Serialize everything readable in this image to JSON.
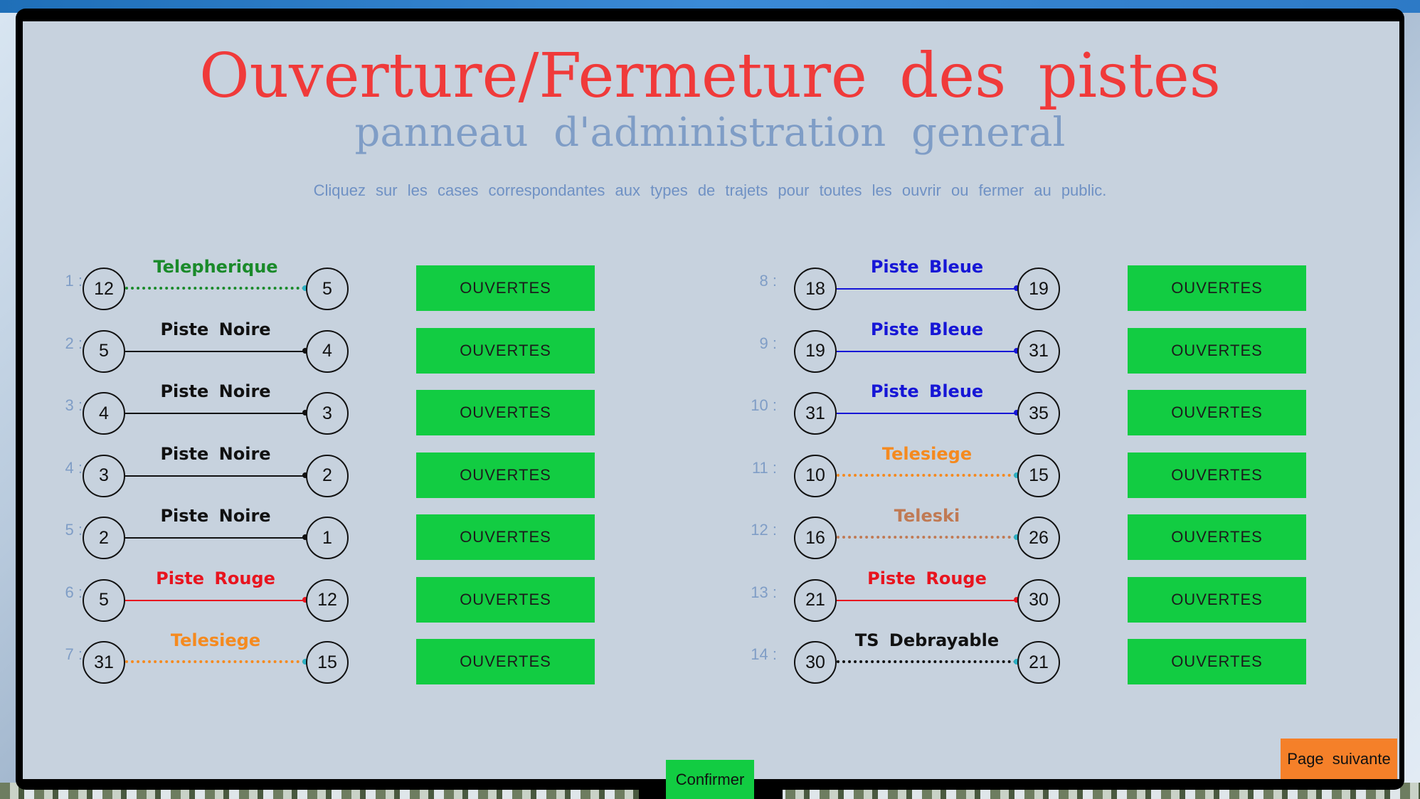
{
  "header": {
    "title": "Ouverture/Fermeture des pistes",
    "subtitle": "panneau d'administration general",
    "instruction": "Cliquez sur les cases correspondantes aux types de trajets pour toutes les ouvrir ou fermer au public."
  },
  "routes": [
    {
      "index": "1 :",
      "from": "12",
      "to": "5",
      "type": "Telepherique",
      "status": "OUVERTES",
      "color": "#1a8a2a",
      "style": "dotted",
      "end": "#2bb0c4"
    },
    {
      "index": "2 :",
      "from": "5",
      "to": "4",
      "type": "Piste Noire",
      "status": "OUVERTES",
      "color": "#111111",
      "style": "solid",
      "end": "#111111"
    },
    {
      "index": "3 :",
      "from": "4",
      "to": "3",
      "type": "Piste Noire",
      "status": "OUVERTES",
      "color": "#111111",
      "style": "solid",
      "end": "#111111"
    },
    {
      "index": "4 :",
      "from": "3",
      "to": "2",
      "type": "Piste Noire",
      "status": "OUVERTES",
      "color": "#111111",
      "style": "solid",
      "end": "#111111"
    },
    {
      "index": "5 :",
      "from": "2",
      "to": "1",
      "type": "Piste Noire",
      "status": "OUVERTES",
      "color": "#111111",
      "style": "solid",
      "end": "#111111"
    },
    {
      "index": "6 :",
      "from": "5",
      "to": "12",
      "type": "Piste Rouge",
      "status": "OUVERTES",
      "color": "#e8141e",
      "style": "solid",
      "end": "#e8141e"
    },
    {
      "index": "7 :",
      "from": "31",
      "to": "15",
      "type": "Telesiege",
      "status": "OUVERTES",
      "color": "#f58a1f",
      "style": "dotted",
      "end": "#2bb0c4"
    },
    {
      "index": "8 :",
      "from": "18",
      "to": "19",
      "type": "Piste Bleue",
      "status": "OUVERTES",
      "color": "#1616d6",
      "style": "solid",
      "end": "#1616d6"
    },
    {
      "index": "9 :",
      "from": "19",
      "to": "31",
      "type": "Piste Bleue",
      "status": "OUVERTES",
      "color": "#1616d6",
      "style": "solid",
      "end": "#1616d6"
    },
    {
      "index": "10 :",
      "from": "31",
      "to": "35",
      "type": "Piste Bleue",
      "status": "OUVERTES",
      "color": "#1616d6",
      "style": "solid",
      "end": "#1616d6"
    },
    {
      "index": "11 :",
      "from": "10",
      "to": "15",
      "type": "Telesiege",
      "status": "OUVERTES",
      "color": "#f58a1f",
      "style": "dotted",
      "end": "#2bb0c4"
    },
    {
      "index": "12 :",
      "from": "16",
      "to": "26",
      "type": "Teleski",
      "status": "OUVERTES",
      "color": "#c07a54",
      "style": "dotted",
      "end": "#2bb0c4"
    },
    {
      "index": "13 :",
      "from": "21",
      "to": "30",
      "type": "Piste Rouge",
      "status": "OUVERTES",
      "color": "#e8141e",
      "style": "solid",
      "end": "#e8141e"
    },
    {
      "index": "14 :",
      "from": "30",
      "to": "21",
      "type": "TS Debrayable",
      "status": "OUVERTES",
      "color": "#111111",
      "style": "dotted",
      "end": "#2bb0c4"
    }
  ],
  "footer": {
    "confirm_label": "Confirmer",
    "next_label": "Page suivante"
  },
  "colors": {
    "toggle_open": "#12cc42",
    "next_button": "#f58029",
    "title": "#f03a3a",
    "subtitle": "#7f9dc6"
  }
}
